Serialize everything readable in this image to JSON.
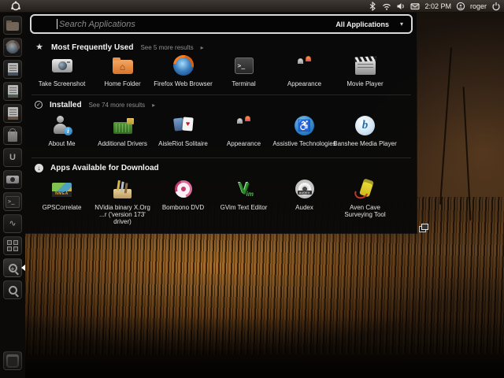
{
  "panel": {
    "logo_icon": "ubuntu-circle-of-friends",
    "clock": "2:02 PM",
    "username": "roger",
    "tray_icons": [
      "bluetooth",
      "network-wifi",
      "volume",
      "mail-envelope",
      "user-menu",
      "power"
    ]
  },
  "launcher": {
    "items": [
      "home-folder",
      "firefox",
      "libreoffice-writer",
      "libreoffice-calc",
      "libreoffice-impress",
      "ubuntu-software-center",
      "ubuntu-one",
      "camera",
      "terminal",
      "system-monitor",
      "workspace-switcher",
      "applications-lens",
      "files-lens",
      "trash"
    ],
    "active_item": "applications-lens"
  },
  "dash": {
    "search": {
      "placeholder": "Search Applications",
      "filter": "All Applications"
    },
    "sections": [
      {
        "title": "Most Frequently Used",
        "more": "See 5 more results",
        "icon": "star",
        "apps": [
          {
            "label": "Take Screenshot",
            "icon": "camera"
          },
          {
            "label": "Home Folder",
            "icon": "orange-folder-home"
          },
          {
            "label": "Firefox Web Browser",
            "icon": "firefox"
          },
          {
            "label": "Terminal",
            "icon": "terminal"
          },
          {
            "label": "Appearance",
            "icon": "shopping-bags"
          },
          {
            "label": "Movie Player",
            "icon": "clapperboard"
          }
        ]
      },
      {
        "title": "Installed",
        "more": "See 74 more results",
        "icon": "check-circle",
        "apps": [
          {
            "label": "About Me",
            "icon": "person-info"
          },
          {
            "label": "Additional Drivers",
            "icon": "circuit-board-lock"
          },
          {
            "label": "AisleRiot Solitaire",
            "icon": "playing-cards"
          },
          {
            "label": "Appearance",
            "icon": "shopping-bags"
          },
          {
            "label": "Assistive Technologies",
            "icon": "accessibility-circle"
          },
          {
            "label": "Banshee Media Player",
            "icon": "banshee-swan"
          }
        ]
      },
      {
        "title": "Apps Available for Download",
        "more": "",
        "icon": "download-circle",
        "apps": [
          {
            "label": "GPSCorrelate",
            "icon": "gps-map"
          },
          {
            "label": "NVidia binary X.Org",
            "label2": "...r ('version 173' driver)",
            "icon": "toolbox"
          },
          {
            "label": "Bombono DVD",
            "icon": "dvd-swirl"
          },
          {
            "label": "GVim Text Editor",
            "icon": "gvim-v"
          },
          {
            "label": "Audex",
            "icon": "cd-disc"
          },
          {
            "label": "Aven Cave Surveying Tool",
            "icon": "surveying-device"
          }
        ]
      }
    ]
  }
}
